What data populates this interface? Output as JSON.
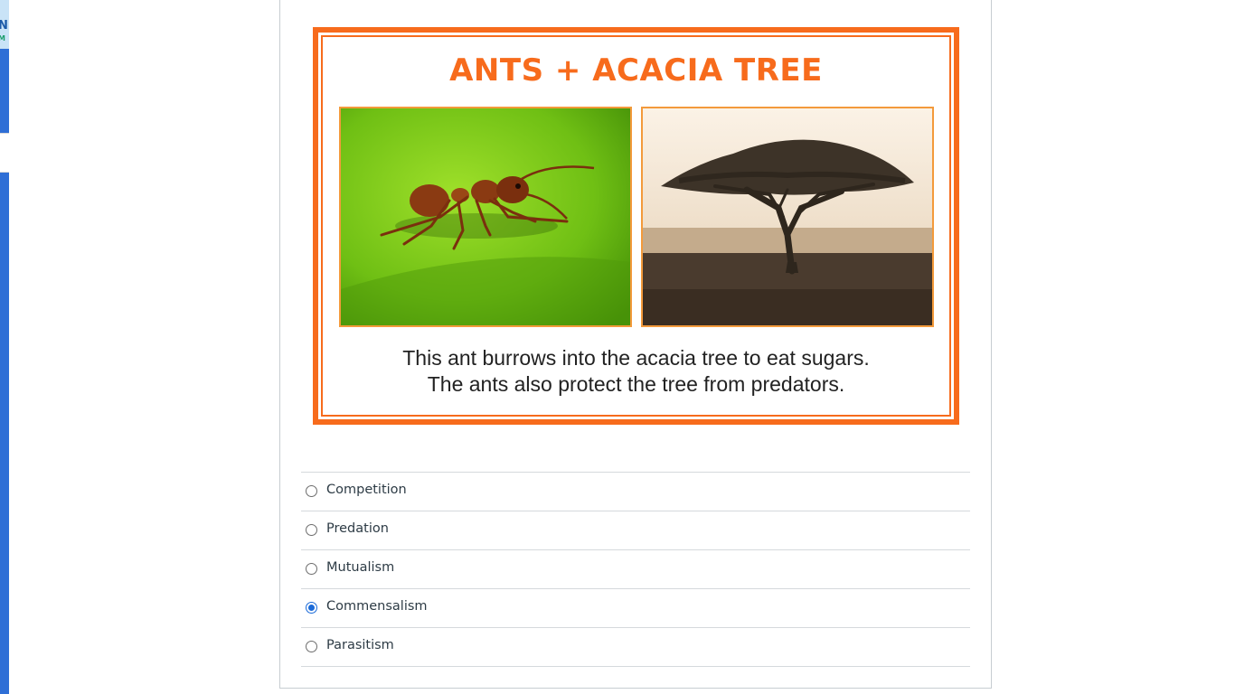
{
  "figure": {
    "title": "ANTS + ACACIA TREE",
    "caption_line1": "This ant burrows into the acacia tree to eat sugars.",
    "caption_line2": "The ants also protect the tree from predators.",
    "accent_color": "#f76b1c"
  },
  "answers": [
    {
      "label": "Competition",
      "selected": false
    },
    {
      "label": "Predation",
      "selected": false
    },
    {
      "label": "Mutualism",
      "selected": false
    },
    {
      "label": "Commensalism",
      "selected": true
    },
    {
      "label": "Parasitism",
      "selected": false
    }
  ],
  "colors": {
    "sidebar": "#2f6fd6",
    "radio_selected": "#1a6ad8"
  }
}
